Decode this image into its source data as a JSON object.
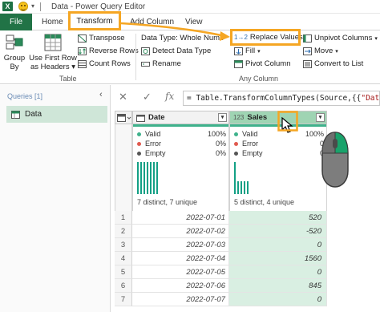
{
  "window": {
    "logo": "X",
    "title": "Data - Power Query Editor"
  },
  "tabs": [
    {
      "label": "File"
    },
    {
      "label": "Home"
    },
    {
      "label": "Transform"
    },
    {
      "label": "Add Column"
    },
    {
      "label": "View"
    }
  ],
  "ribbon": {
    "table_group": {
      "group_by": [
        "Group",
        "By"
      ],
      "use_first_row": [
        "Use First Row",
        "as Headers ▾"
      ],
      "transpose": "Transpose",
      "reverse_rows": "Reverse Rows",
      "count_rows": "Count Rows",
      "label": "Table"
    },
    "any_column_group": {
      "data_type": "Data Type: Whole Numb",
      "detect_data_type": "Detect Data Type",
      "rename": "Rename",
      "replace_values": "Replace Values",
      "fill": "Fill",
      "pivot_column": "Pivot Column",
      "unpivot_columns": "Unpivot Columns",
      "move": "Move",
      "convert_to_list": "Convert to List",
      "label": "Any Column"
    }
  },
  "queries_pane": {
    "label": "Queries [1]",
    "items": [
      {
        "label": "Data"
      }
    ]
  },
  "formula_bar": {
    "prefix": "= Table.TransformColumnTypes(Source,{{",
    "string": "\"Date\"",
    "suffix": ", t"
  },
  "grid": {
    "columns": [
      {
        "name": "Date",
        "type_icon": "calendar-icon",
        "valid_label": "Valid",
        "valid_pct": "100%",
        "error_label": "Error",
        "error_pct": "0%",
        "empty_label": "Empty",
        "empty_pct": "0%",
        "distinct": "7 distinct, 7 unique",
        "histogram": [
          1,
          1,
          1,
          1,
          1,
          1,
          1
        ]
      },
      {
        "name": "Sales",
        "type_icon": "123",
        "valid_label": "Valid",
        "valid_pct": "100%",
        "error_label": "Error",
        "error_pct": "0",
        "empty_label": "Empty",
        "empty_pct": "0",
        "distinct": "5 distinct, 4 unique",
        "histogram": [
          2.5,
          1,
          1,
          1,
          1
        ]
      }
    ],
    "rows": [
      {
        "n": "1",
        "date": "2022-07-01",
        "sales": "520"
      },
      {
        "n": "2",
        "date": "2022-07-02",
        "sales": "-520"
      },
      {
        "n": "3",
        "date": "2022-07-03",
        "sales": "0"
      },
      {
        "n": "4",
        "date": "2022-07-04",
        "sales": "1560"
      },
      {
        "n": "5",
        "date": "2022-07-05",
        "sales": "0"
      },
      {
        "n": "6",
        "date": "2022-07-06",
        "sales": "845"
      },
      {
        "n": "7",
        "date": "2022-07-07",
        "sales": "0"
      }
    ]
  },
  "colors": {
    "excel_green": "#217346",
    "highlight_orange": "#f5a623",
    "quality_bar": "#3fb28c",
    "selected_column": "#d9efe2",
    "error_red": "#e05a4f"
  }
}
